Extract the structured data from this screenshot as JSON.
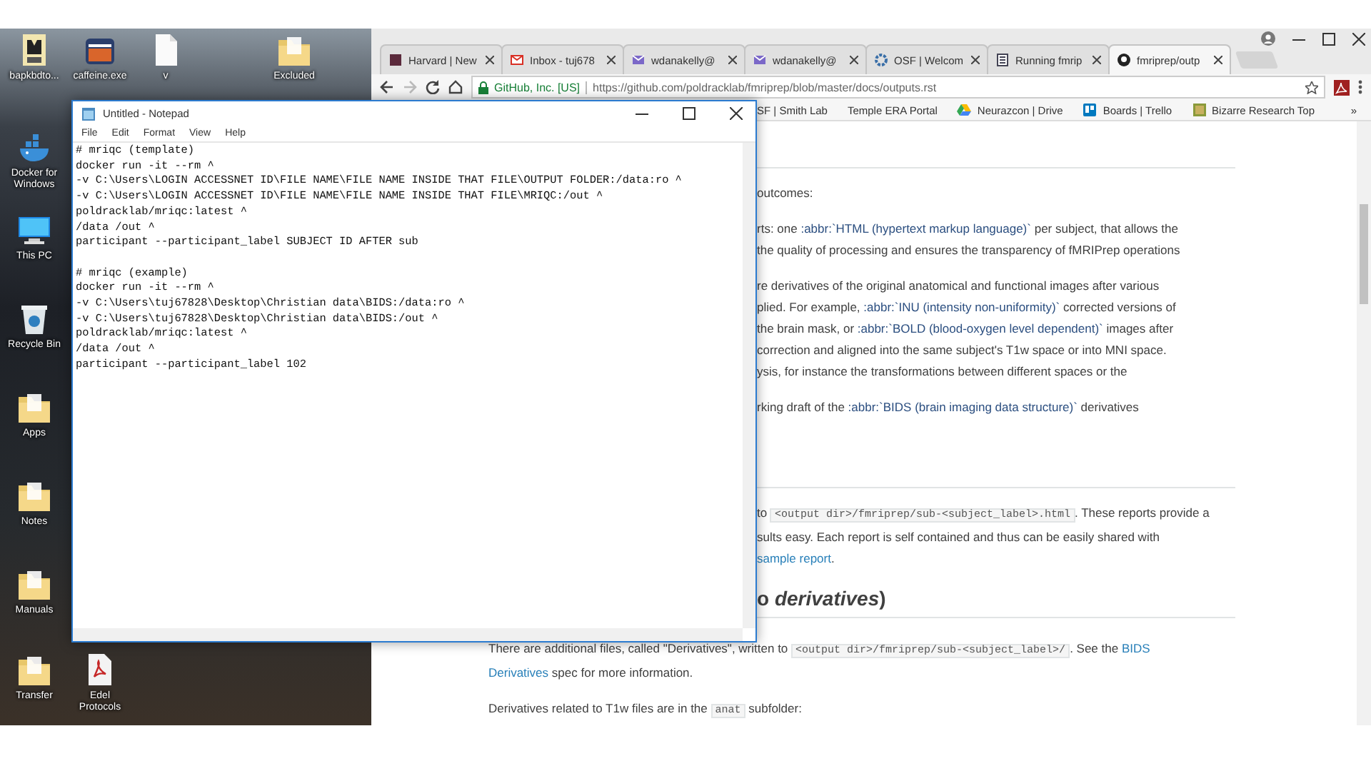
{
  "desktop": {
    "icons": [
      {
        "label": "bapkbdto...",
        "kind": "film"
      },
      {
        "label": "caffeine.exe",
        "kind": "box"
      },
      {
        "label": "v",
        "kind": "file"
      },
      {
        "label": "Excluded",
        "kind": "folder"
      },
      {
        "label": "Docker for Windows",
        "kind": "whale"
      },
      {
        "label": "This PC",
        "kind": "monitor"
      },
      {
        "label": "Recycle Bin",
        "kind": "bin"
      },
      {
        "label": "Apps",
        "kind": "folder"
      },
      {
        "label": "Notes",
        "kind": "folder"
      },
      {
        "label": "Manuals",
        "kind": "folder"
      },
      {
        "label": "Transfer",
        "kind": "folder"
      },
      {
        "label": "Edel Protocols",
        "kind": "pdf"
      }
    ]
  },
  "browser": {
    "tabs": [
      {
        "title": "Harvard | New",
        "kind": "crest",
        "selected": false
      },
      {
        "title": "Inbox - tuj678",
        "kind": "gmail",
        "selected": false
      },
      {
        "title": "wdanakelly@",
        "kind": "mail",
        "selected": false
      },
      {
        "title": "wdanakelly@",
        "kind": "mail",
        "selected": false
      },
      {
        "title": "OSF | Welcom",
        "kind": "gear",
        "selected": false
      },
      {
        "title": "Running fmrip",
        "kind": "doc",
        "selected": false
      },
      {
        "title": "fmriprep/outp",
        "kind": "github",
        "selected": true
      }
    ],
    "identity": "GitHub, Inc. [US]",
    "url": "https://github.com/poldracklab/fmriprep/blob/master/docs/outputs.rst",
    "bookmarks": [
      {
        "label": "SF | Smith Lab"
      },
      {
        "label": "Temple ERA Portal"
      },
      {
        "label": "Neurazcon | Drive",
        "kind": "drive"
      },
      {
        "label": "Boards | Trello",
        "kind": "trello"
      },
      {
        "label": "Bizarre Research Top",
        "kind": "image"
      }
    ],
    "bookmarks_overflow": "»",
    "content": {
      "upper": [
        {
          "kind": "rule"
        },
        {
          "kind": "paragraph",
          "lines": [
            [
              {
                "kind": "text",
                "text": "outcomes:"
              }
            ]
          ]
        },
        {
          "kind": "paragraph",
          "lines": [
            [
              {
                "kind": "text",
                "text": "rts: one "
              },
              {
                "kind": "abbr",
                "text": ":abbr:`HTML (hypertext markup language)`"
              },
              {
                "kind": "text",
                "text": " per subject, that allows the"
              }
            ],
            [
              {
                "kind": "text",
                "text": "the quality of processing and ensures the transparency of fMRIPrep operations"
              }
            ]
          ]
        },
        {
          "kind": "paragraph",
          "lines": [
            [
              {
                "kind": "text",
                "text": "re derivatives of the original anatomical and functional images after various"
              }
            ],
            [
              {
                "kind": "text",
                "text": "plied. For example, "
              },
              {
                "kind": "abbr",
                "text": ":abbr:`INU (intensity non-uniformity)`"
              },
              {
                "kind": "text",
                "text": " corrected versions of"
              }
            ],
            [
              {
                "kind": "text",
                "text": "the brain mask, or "
              },
              {
                "kind": "abbr",
                "text": ":abbr:`BOLD (blood-oxygen level dependent)`"
              },
              {
                "kind": "text",
                "text": " images after"
              }
            ],
            [
              {
                "kind": "text",
                "text": "correction and aligned into the same subject's T1w space or into MNI space."
              }
            ],
            [
              {
                "kind": "text",
                "text": "ysis, for instance the transformations between different spaces or the"
              }
            ]
          ]
        },
        {
          "kind": "paragraph",
          "lines": [
            [
              {
                "kind": "text",
                "text": "rking draft of the "
              },
              {
                "kind": "abbr",
                "text": ":abbr:`BIDS (brain imaging data structure)`"
              },
              {
                "kind": "text",
                "text": " derivatives"
              }
            ]
          ]
        },
        {
          "kind": "rule"
        },
        {
          "kind": "paragraph",
          "lines": [
            [
              {
                "kind": "text",
                "text": "to "
              },
              {
                "kind": "code",
                "text": "<output dir>/fmriprep/sub-<subject_label>.html"
              },
              {
                "kind": "text",
                "text": ". These reports provide a"
              }
            ],
            [
              {
                "kind": "text",
                "text": "sults easy. Each report is self contained and thus can be easily shared with"
              }
            ],
            [
              {
                "kind": "link",
                "text": "sample report"
              },
              {
                "kind": "text",
                "text": "."
              }
            ]
          ]
        },
        {
          "kind": "heading",
          "lines": [
            [
              {
                "kind": "text",
                "text": "o "
              },
              {
                "kind": "em",
                "text": "derivatives"
              },
              {
                "kind": "text",
                "text": ")"
              }
            ]
          ]
        }
      ],
      "lower": [
        {
          "kind": "paragraph",
          "lines": [
            [
              {
                "kind": "text",
                "text": "There are additional files, called \"Derivatives\", written to "
              },
              {
                "kind": "code",
                "text": "<output dir>/fmriprep/sub-<subject_label>/"
              },
              {
                "kind": "text",
                "text": ". See the "
              },
              {
                "kind": "link",
                "text": "BIDS"
              }
            ],
            [
              {
                "kind": "link",
                "text": "Derivatives"
              },
              {
                "kind": "text",
                "text": " spec for more information."
              }
            ]
          ]
        },
        {
          "kind": "paragraph",
          "lines": [
            [
              {
                "kind": "text",
                "text": "Derivatives related to T1w files are in the "
              },
              {
                "kind": "code",
                "text": "anat"
              },
              {
                "kind": "text",
                "text": " subfolder:"
              }
            ]
          ]
        }
      ]
    }
  },
  "notepad": {
    "title": "Untitled - Notepad",
    "menu": [
      "File",
      "Edit",
      "Format",
      "View",
      "Help"
    ],
    "blocks": [
      [
        "# mriqc (template)",
        "docker run -it --rm ^",
        "-v C:\\Users\\LOGIN ACCESSNET ID\\FILE NAME\\FILE NAME INSIDE THAT FILE\\OUTPUT FOLDER:/data:ro ^",
        "-v C:\\Users\\LOGIN ACCESSNET ID\\FILE NAME\\FILE NAME INSIDE THAT FILE\\MRIQC:/out ^",
        "poldracklab/mriqc:latest ^",
        "/data /out ^",
        "participant --participant_label SUBJECT ID AFTER sub"
      ],
      [
        "# mriqc (example)",
        "docker run -it --rm ^",
        "-v C:\\Users\\tuj67828\\Desktop\\Christian data\\BIDS:/data:ro ^",
        "-v C:\\Users\\tuj67828\\Desktop\\Christian data\\BIDS:/out ^",
        "poldracklab/mriqc:latest ^",
        "/data /out ^",
        "participant --participant_label 102"
      ]
    ]
  }
}
